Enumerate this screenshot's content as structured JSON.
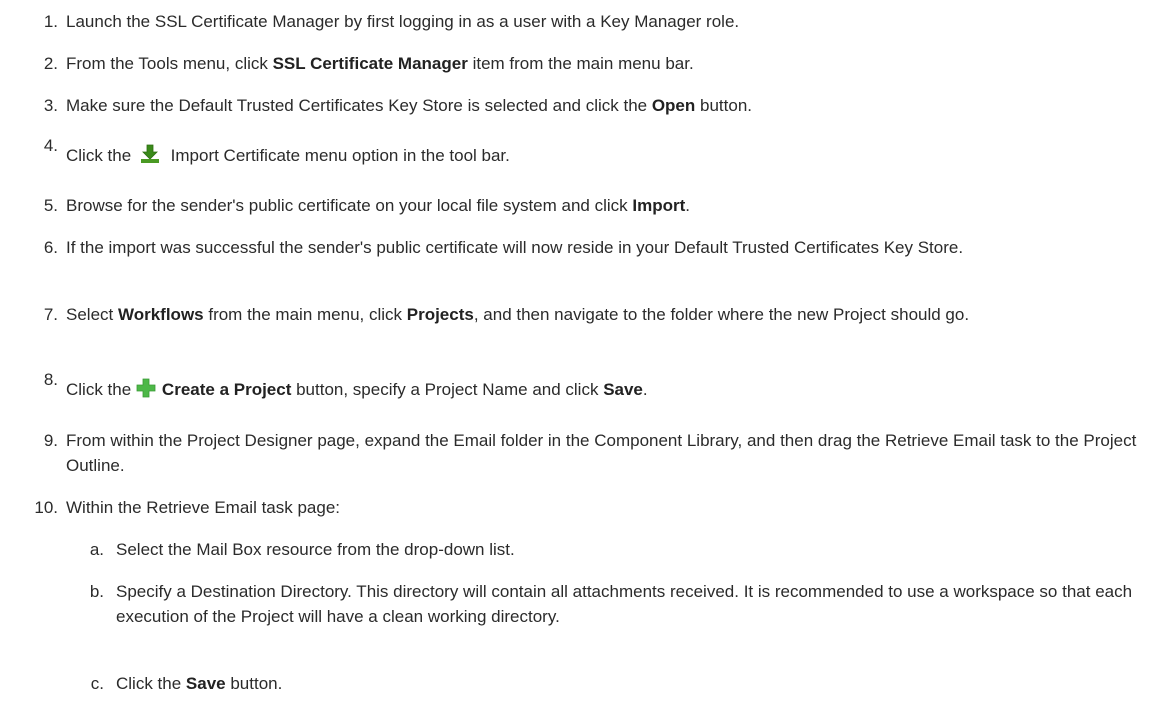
{
  "steps": [
    {
      "num": "1.",
      "parts": [
        {
          "t": "Launch the SSL Certificate Manager by first logging in as a user with a Key Manager role."
        }
      ]
    },
    {
      "num": "2.",
      "parts": [
        {
          "t": "From the Tools menu, click "
        },
        {
          "b": "SSL Certificate Manager"
        },
        {
          "t": " item from the main menu bar."
        }
      ]
    },
    {
      "num": "3.",
      "parts": [
        {
          "t": "Make sure the Default Trusted Certificates Key Store is selected and click the "
        },
        {
          "b": "Open"
        },
        {
          "t": " button."
        }
      ]
    },
    {
      "num": "4.",
      "parts": [
        {
          "t": "Click the "
        },
        {
          "icon": "import-icon"
        },
        {
          "t": " Import Certificate menu option in the tool bar."
        }
      ]
    },
    {
      "num": "5.",
      "parts": [
        {
          "t": "Browse for the sender's public certificate on your local file system and click "
        },
        {
          "b": "Import"
        },
        {
          "t": "."
        }
      ]
    },
    {
      "num": "6.",
      "parts": [
        {
          "t": "If the import was successful the sender's public certificate will now reside in your Default Trusted Certificates Key Store."
        }
      ]
    },
    {
      "num": "7.",
      "parts": [
        {
          "t": "Select "
        },
        {
          "b": "Workflows"
        },
        {
          "t": " from the main menu, click "
        },
        {
          "b": "Projects"
        },
        {
          "t": ", and then navigate to the folder where the new Project should go."
        }
      ]
    },
    {
      "num": "8.",
      "parts": [
        {
          "t": "Click the "
        },
        {
          "icon": "plus-icon"
        },
        {
          "b": "Create a Project"
        },
        {
          "t": " button, specify a Project Name and click "
        },
        {
          "b": "Save"
        },
        {
          "t": "."
        }
      ]
    },
    {
      "num": "9.",
      "parts": [
        {
          "t": "From within the Project Designer page, expand the Email folder in the Component Library, and then drag the Retrieve Email task to the Project Outline."
        }
      ]
    },
    {
      "num": "10.",
      "parts": [
        {
          "t": "Within the Retrieve Email task page:"
        }
      ]
    }
  ],
  "substeps": [
    {
      "num": "a.",
      "parts": [
        {
          "t": "Select the Mail Box resource from the drop-down list."
        }
      ]
    },
    {
      "num": "b.",
      "parts": [
        {
          "t": "Specify a Destination Directory. This directory will contain all attachments received. It is recommended to use a workspace so that each execution of the Project will have a clean working directory."
        }
      ]
    },
    {
      "num": "c.",
      "parts": [
        {
          "t": "Click the "
        },
        {
          "b": "Save"
        },
        {
          "t": " button."
        }
      ]
    }
  ],
  "icon_colors": {
    "import": "#3a8a1a",
    "plus": "#4db848"
  }
}
